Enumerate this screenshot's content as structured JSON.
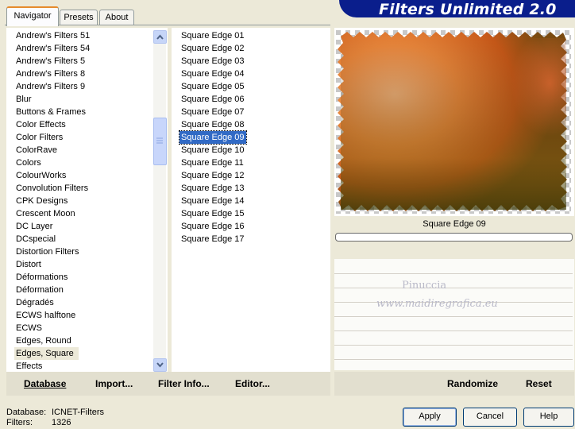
{
  "tabs": [
    {
      "label": "Navigator"
    },
    {
      "label": "Presets"
    },
    {
      "label": "About"
    }
  ],
  "app_title": "Filters Unlimited 2.0",
  "categories": [
    "Andrew's Filters 51",
    "Andrew's Filters 54",
    "Andrew's Filters 5",
    "Andrew's Filters 8",
    "Andrew's Filters 9",
    "Blur",
    "Buttons & Frames",
    "Color Effects",
    "Color Filters",
    "ColorRave",
    "Colors",
    "ColourWorks",
    "Convolution Filters",
    "CPK Designs",
    "Crescent Moon",
    "DC Layer",
    "DCspecial",
    "Distortion Filters",
    "Distort",
    "Déformations",
    "Déformation",
    "Dégradés",
    "ECWS halftone",
    "ECWS",
    "Edges, Round",
    "Edges, Square",
    "Effects"
  ],
  "selected_category": "Edges, Square",
  "filters": [
    "Square Edge 01",
    "Square Edge 02",
    "Square Edge 03",
    "Square Edge 04",
    "Square Edge 05",
    "Square Edge 06",
    "Square Edge 07",
    "Square Edge 08",
    "Square Edge 09",
    "Square Edge 10",
    "Square Edge 11",
    "Square Edge 12",
    "Square Edge 13",
    "Square Edge 14",
    "Square Edge 15",
    "Square Edge 16",
    "Square Edge 17"
  ],
  "selected_filter": "Square Edge 09",
  "preview": {
    "caption": "Square Edge 09"
  },
  "watermark": {
    "line1": "Pinuccia",
    "line2": "www.maidiregrafica.eu"
  },
  "toolbar": {
    "database": "Database",
    "import": "Import...",
    "filter_info": "Filter Info...",
    "editor": "Editor...",
    "randomize": "Randomize",
    "reset": "Reset"
  },
  "status": {
    "database_label": "Database:",
    "database_value": "ICNET-Filters",
    "filters_label": "Filters:",
    "filters_value": "1326"
  },
  "buttons": {
    "apply": "Apply",
    "cancel": "Cancel",
    "help": "Help"
  },
  "colors": {
    "selection": "#316ac5",
    "banner": "#0a1e8c",
    "tab_accent": "#e68b2c"
  }
}
